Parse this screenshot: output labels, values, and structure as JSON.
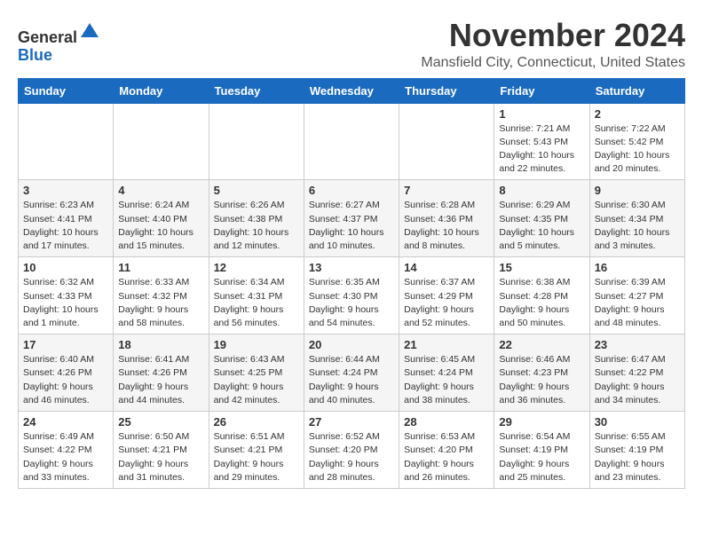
{
  "header": {
    "logo_line1": "General",
    "logo_line2": "Blue",
    "month_title": "November 2024",
    "location": "Mansfield City, Connecticut, United States"
  },
  "weekdays": [
    "Sunday",
    "Monday",
    "Tuesday",
    "Wednesday",
    "Thursday",
    "Friday",
    "Saturday"
  ],
  "weeks": [
    [
      {
        "day": "",
        "info": ""
      },
      {
        "day": "",
        "info": ""
      },
      {
        "day": "",
        "info": ""
      },
      {
        "day": "",
        "info": ""
      },
      {
        "day": "",
        "info": ""
      },
      {
        "day": "1",
        "info": "Sunrise: 7:21 AM\nSunset: 5:43 PM\nDaylight: 10 hours\nand 22 minutes."
      },
      {
        "day": "2",
        "info": "Sunrise: 7:22 AM\nSunset: 5:42 PM\nDaylight: 10 hours\nand 20 minutes."
      }
    ],
    [
      {
        "day": "3",
        "info": "Sunrise: 6:23 AM\nSunset: 4:41 PM\nDaylight: 10 hours\nand 17 minutes."
      },
      {
        "day": "4",
        "info": "Sunrise: 6:24 AM\nSunset: 4:40 PM\nDaylight: 10 hours\nand 15 minutes."
      },
      {
        "day": "5",
        "info": "Sunrise: 6:26 AM\nSunset: 4:38 PM\nDaylight: 10 hours\nand 12 minutes."
      },
      {
        "day": "6",
        "info": "Sunrise: 6:27 AM\nSunset: 4:37 PM\nDaylight: 10 hours\nand 10 minutes."
      },
      {
        "day": "7",
        "info": "Sunrise: 6:28 AM\nSunset: 4:36 PM\nDaylight: 10 hours\nand 8 minutes."
      },
      {
        "day": "8",
        "info": "Sunrise: 6:29 AM\nSunset: 4:35 PM\nDaylight: 10 hours\nand 5 minutes."
      },
      {
        "day": "9",
        "info": "Sunrise: 6:30 AM\nSunset: 4:34 PM\nDaylight: 10 hours\nand 3 minutes."
      }
    ],
    [
      {
        "day": "10",
        "info": "Sunrise: 6:32 AM\nSunset: 4:33 PM\nDaylight: 10 hours\nand 1 minute."
      },
      {
        "day": "11",
        "info": "Sunrise: 6:33 AM\nSunset: 4:32 PM\nDaylight: 9 hours\nand 58 minutes."
      },
      {
        "day": "12",
        "info": "Sunrise: 6:34 AM\nSunset: 4:31 PM\nDaylight: 9 hours\nand 56 minutes."
      },
      {
        "day": "13",
        "info": "Sunrise: 6:35 AM\nSunset: 4:30 PM\nDaylight: 9 hours\nand 54 minutes."
      },
      {
        "day": "14",
        "info": "Sunrise: 6:37 AM\nSunset: 4:29 PM\nDaylight: 9 hours\nand 52 minutes."
      },
      {
        "day": "15",
        "info": "Sunrise: 6:38 AM\nSunset: 4:28 PM\nDaylight: 9 hours\nand 50 minutes."
      },
      {
        "day": "16",
        "info": "Sunrise: 6:39 AM\nSunset: 4:27 PM\nDaylight: 9 hours\nand 48 minutes."
      }
    ],
    [
      {
        "day": "17",
        "info": "Sunrise: 6:40 AM\nSunset: 4:26 PM\nDaylight: 9 hours\nand 46 minutes."
      },
      {
        "day": "18",
        "info": "Sunrise: 6:41 AM\nSunset: 4:26 PM\nDaylight: 9 hours\nand 44 minutes."
      },
      {
        "day": "19",
        "info": "Sunrise: 6:43 AM\nSunset: 4:25 PM\nDaylight: 9 hours\nand 42 minutes."
      },
      {
        "day": "20",
        "info": "Sunrise: 6:44 AM\nSunset: 4:24 PM\nDaylight: 9 hours\nand 40 minutes."
      },
      {
        "day": "21",
        "info": "Sunrise: 6:45 AM\nSunset: 4:24 PM\nDaylight: 9 hours\nand 38 minutes."
      },
      {
        "day": "22",
        "info": "Sunrise: 6:46 AM\nSunset: 4:23 PM\nDaylight: 9 hours\nand 36 minutes."
      },
      {
        "day": "23",
        "info": "Sunrise: 6:47 AM\nSunset: 4:22 PM\nDaylight: 9 hours\nand 34 minutes."
      }
    ],
    [
      {
        "day": "24",
        "info": "Sunrise: 6:49 AM\nSunset: 4:22 PM\nDaylight: 9 hours\nand 33 minutes."
      },
      {
        "day": "25",
        "info": "Sunrise: 6:50 AM\nSunset: 4:21 PM\nDaylight: 9 hours\nand 31 minutes."
      },
      {
        "day": "26",
        "info": "Sunrise: 6:51 AM\nSunset: 4:21 PM\nDaylight: 9 hours\nand 29 minutes."
      },
      {
        "day": "27",
        "info": "Sunrise: 6:52 AM\nSunset: 4:20 PM\nDaylight: 9 hours\nand 28 minutes."
      },
      {
        "day": "28",
        "info": "Sunrise: 6:53 AM\nSunset: 4:20 PM\nDaylight: 9 hours\nand 26 minutes."
      },
      {
        "day": "29",
        "info": "Sunrise: 6:54 AM\nSunset: 4:19 PM\nDaylight: 9 hours\nand 25 minutes."
      },
      {
        "day": "30",
        "info": "Sunrise: 6:55 AM\nSunset: 4:19 PM\nDaylight: 9 hours\nand 23 minutes."
      }
    ]
  ]
}
